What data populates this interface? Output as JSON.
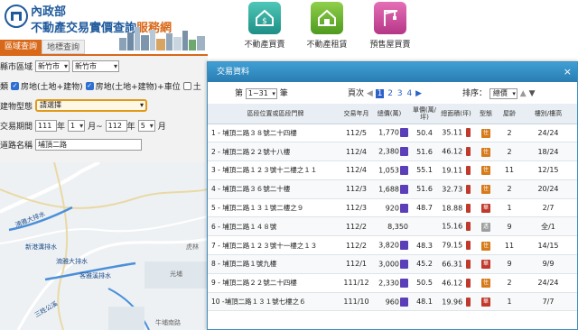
{
  "header": {
    "ministry": "內政部",
    "title_main": "不動產交易實價查詢",
    "title_accent": "服務網",
    "nav": [
      {
        "label": "不動產買賣",
        "icon": "house-dollar-icon"
      },
      {
        "label": "不動產租賃",
        "icon": "house-icon"
      },
      {
        "label": "預售屋買賣",
        "icon": "crane-icon"
      }
    ]
  },
  "tabs": {
    "active": "區域查詢",
    "inactive": "地標查詢"
  },
  "search": {
    "area_label": "縣市區域",
    "county_value": "新竹市",
    "district_value": "新竹市",
    "type_row_label": "類",
    "checkbox_1": "房地(土地+建物)",
    "checkbox_2": "房地(土地+建物)+車位",
    "checkbox_3": "土",
    "building_label": "建物型態",
    "building_value": "請選擇",
    "period_label": "交易期間",
    "year_from": "111",
    "year_label": "年",
    "month_from": "1",
    "month_label": "月~",
    "year_to": "112",
    "year_label_2": "年",
    "month_to": "5",
    "month_label_2": "月",
    "road_label": "道路名稱",
    "road_value": "埔頂二路"
  },
  "map": {
    "labels": [
      "湳雅大排水",
      "新港溝排水",
      "湳雅大排水",
      "客雅溪排水",
      "光埔",
      "虎林",
      "牛埔南路",
      "三姓公溪"
    ]
  },
  "dialog": {
    "title": "交易資料",
    "close": "×",
    "pager_prefix": "第",
    "pager_range": "1~31",
    "pager_suffix": "筆",
    "page_label": "頁次",
    "pages": [
      "1",
      "2",
      "3",
      "4"
    ],
    "current_page": "1",
    "sort_label": "排序：",
    "sort_value": "總價",
    "columns": [
      "區段位置或區段門牌",
      "交易年月",
      "總價(萬)",
      "單價(萬/坪)",
      "總面積(坪)",
      "型態",
      "屋齡",
      "樓別/樓高"
    ],
    "rows": [
      {
        "addr": "1 - 埔頂二路３８號二十四樓",
        "date": "112/5",
        "total": "1,770",
        "unit": "50.4",
        "area": "35.11",
        "type": "住",
        "age": "2",
        "floor": "24/24"
      },
      {
        "addr": "2 - 埔頂二路２２號十八樓",
        "date": "112/4",
        "total": "2,380",
        "unit": "51.6",
        "area": "46.12",
        "type": "住",
        "age": "2",
        "floor": "18/24"
      },
      {
        "addr": "3 - 埔頂二路１２３號十二樓之１１",
        "date": "112/4",
        "total": "1,053",
        "unit": "55.1",
        "area": "19.11",
        "type": "住",
        "age": "11",
        "floor": "12/15"
      },
      {
        "addr": "4 - 埔頂二路３６號二十樓",
        "date": "112/3",
        "total": "1,688",
        "unit": "51.6",
        "area": "32.73",
        "type": "住",
        "age": "2",
        "floor": "20/24"
      },
      {
        "addr": "5 - 埔頂二路１３１號二樓之９",
        "date": "112/3",
        "total": "920",
        "unit": "48.7",
        "area": "18.88",
        "type": "華",
        "age": "1",
        "floor": "2/7"
      },
      {
        "addr": "6 - 埔頂二路１４８號",
        "date": "112/2",
        "total": "8,350",
        "unit": "",
        "area": "15.16",
        "type": "透",
        "age": "9",
        "floor": "全/1"
      },
      {
        "addr": "7 - 埔頂二路１２３號十一樓之１３",
        "date": "112/2",
        "total": "3,820",
        "unit": "48.3",
        "area": "79.15",
        "type": "住",
        "age": "11",
        "floor": "14/15"
      },
      {
        "addr": "8 - 埔頂二路１號九樓",
        "date": "112/1",
        "total": "3,000",
        "unit": "45.2",
        "area": "66.31",
        "type": "華",
        "age": "9",
        "floor": "9/9"
      },
      {
        "addr": "9 - 埔頂二路２２號二十四樓",
        "date": "111/12",
        "total": "2,330",
        "unit": "50.5",
        "area": "46.12",
        "type": "住",
        "age": "2",
        "floor": "24/24"
      },
      {
        "addr": "10 -埔頂二路１３１號七樓之６",
        "date": "111/10",
        "total": "960",
        "unit": "48.1",
        "area": "19.96",
        "type": "華",
        "age": "1",
        "floor": "7/7"
      }
    ]
  },
  "colors": {
    "accent": "#d9691a",
    "brand_blue": "#1f5a9c",
    "dialog_header": "#2a7db3"
  }
}
